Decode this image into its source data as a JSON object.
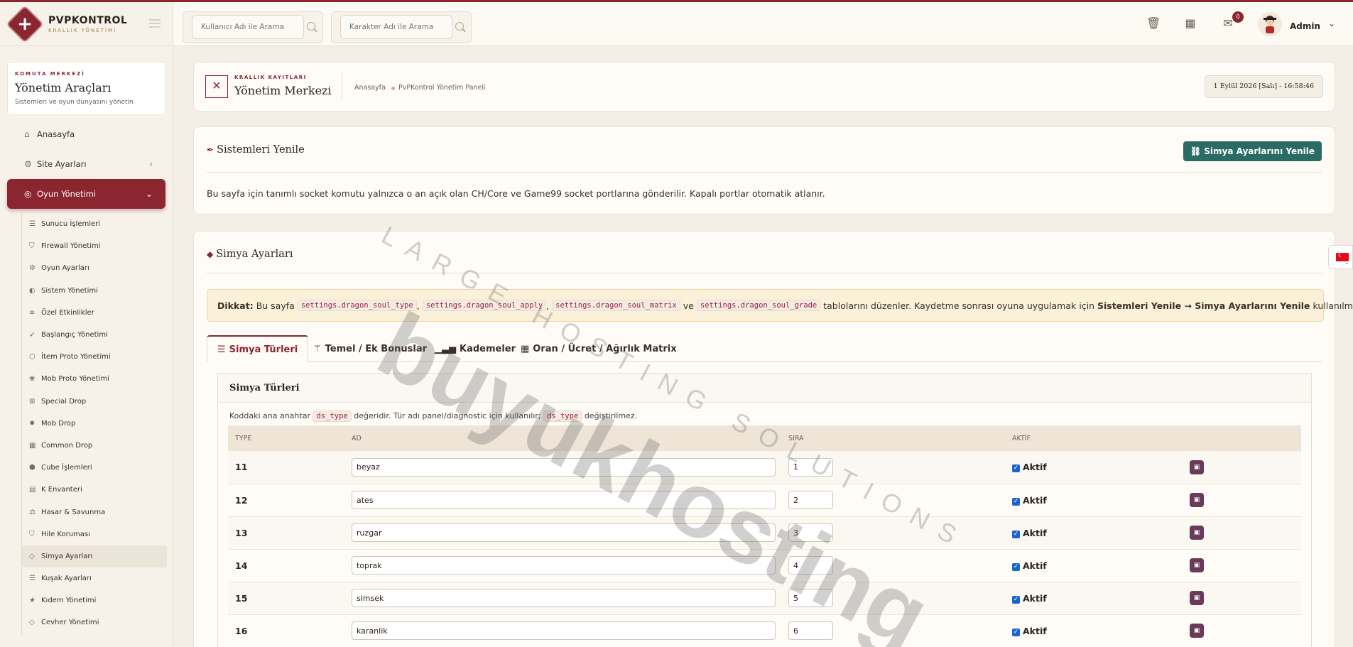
{
  "brand": {
    "name": "PVPKONTROL",
    "subtitle": "KRALLIK YÖNETİMİ"
  },
  "sidebar": {
    "command": {
      "kicker": "KOMUTA MERKEZİ",
      "title": "Yönetim Araçları",
      "subtitle": "Sistemleri ve oyun dünyasını yönetin"
    },
    "main_items": [
      {
        "label": "Anasayfa",
        "icon": "home-icon"
      },
      {
        "label": "Site Ayarları",
        "icon": "gear-icon"
      },
      {
        "label": "Oyun Yönetimi",
        "icon": "gamepad-icon",
        "active": true
      }
    ],
    "sub_items": [
      {
        "label": "Sunucu İşlemleri",
        "icon": "server-icon"
      },
      {
        "label": "Firewall Yönetimi",
        "icon": "shield-icon"
      },
      {
        "label": "Oyun Ayarları",
        "icon": "gears-icon"
      },
      {
        "label": "Sistem Yönetimi",
        "icon": "toggle-icon"
      },
      {
        "label": "Özel Etkinlikler",
        "icon": "sliders-icon"
      },
      {
        "label": "Başlangıç Yönetimi",
        "icon": "rocket-icon"
      },
      {
        "label": "İtem Proto Yönetimi",
        "icon": "cube-icon"
      },
      {
        "label": "Mob Proto Yönetimi",
        "icon": "paw-icon"
      },
      {
        "label": "Special Drop",
        "icon": "gift-icon"
      },
      {
        "label": "Mob Drop",
        "icon": "bug-icon"
      },
      {
        "label": "Common Drop",
        "icon": "grid-icon"
      },
      {
        "label": "Cube İşlemleri",
        "icon": "cubes-icon"
      },
      {
        "label": "K Envanteri",
        "icon": "table-icon"
      },
      {
        "label": "Hasar & Savunma",
        "icon": "scale-icon"
      },
      {
        "label": "Hile Koruması",
        "icon": "shield-icon"
      },
      {
        "label": "Simya Ayarları",
        "icon": "gem-icon",
        "active": true
      },
      {
        "label": "Kuşak Ayarları",
        "icon": "list-icon"
      },
      {
        "label": "Kıdem Yönetimi",
        "icon": "star-icon"
      },
      {
        "label": "Cevher Yönetimi",
        "icon": "gem-icon"
      }
    ]
  },
  "header": {
    "search_user_placeholder": "Kullanıcı Adı ile Arama",
    "search_char_placeholder": "Karakter Adı ile Arama",
    "notification_count": "0",
    "admin_name": "Admin"
  },
  "titlebar": {
    "kicker": "KRALLIK KAYITLARI",
    "title": "Yönetim Merkezi",
    "breadcrumb_home": "Anasayfa",
    "breadcrumb_current": "PvPKontrol Yönetim Paneli",
    "datetime": "1 Eylül 2026 [Salı] - 16:58:46"
  },
  "systems": {
    "title": "Sistemleri Yenile",
    "button": "Simya Ayarlarını Yenile",
    "description": "Bu sayfa için tanımlı socket komutu yalnızca o an açık olan CH/Core ve Game99 socket portlarına gönderilir. Kapalı portlar otomatik atlanır."
  },
  "simya": {
    "title": "Simya Ayarları",
    "warn": {
      "label": "Dikkat:",
      "pre": "Bu sayfa",
      "codes": [
        "settings.dragon_soul_type",
        "settings.dragon_soul_apply",
        "settings.dragon_soul_matrix",
        "settings.dragon_soul_grade"
      ],
      "sep": ",",
      "and": "ve",
      "post": "tablolarını düzenler. Kaydetme sonrası oyuna uygulamak için",
      "bold": "Sistemleri Yenile → Simya Ayarlarını Yenile",
      "end": "kullanılmalı."
    },
    "tabs": [
      "Simya Türleri",
      "Temel / Ek Bonuslar",
      "Kademeler",
      "Oran / Ücret / Ağırlık Matrix"
    ],
    "panel": {
      "title": "Simya Türleri",
      "note_pre": "Koddaki ana anahtar",
      "note_code": "ds_type",
      "note_mid": "değeridir. Tür adı panel/diagnostic için kullanılır;",
      "note_end": "değiştirilmez."
    },
    "columns": [
      "TYPE",
      "AD",
      "SIRA",
      "AKTİF"
    ],
    "rows": [
      {
        "type": "11",
        "name": "beyaz",
        "order": "1",
        "active_label": "Aktif"
      },
      {
        "type": "12",
        "name": "ates",
        "order": "2",
        "active_label": "Aktif"
      },
      {
        "type": "13",
        "name": "ruzgar",
        "order": "3",
        "active_label": "Aktif"
      },
      {
        "type": "14",
        "name": "toprak",
        "order": "4",
        "active_label": "Aktif"
      },
      {
        "type": "15",
        "name": "simsek",
        "order": "5",
        "active_label": "Aktif"
      },
      {
        "type": "16",
        "name": "karanlik",
        "order": "6",
        "active_label": "Aktif"
      }
    ]
  },
  "watermark": {
    "main": "buyukhosting",
    "sub": "LARGE HOSTING SOLUTIONS"
  },
  "colors": {
    "accent": "#8b2630",
    "teal": "#2a6b64",
    "gold": "#a08040"
  }
}
